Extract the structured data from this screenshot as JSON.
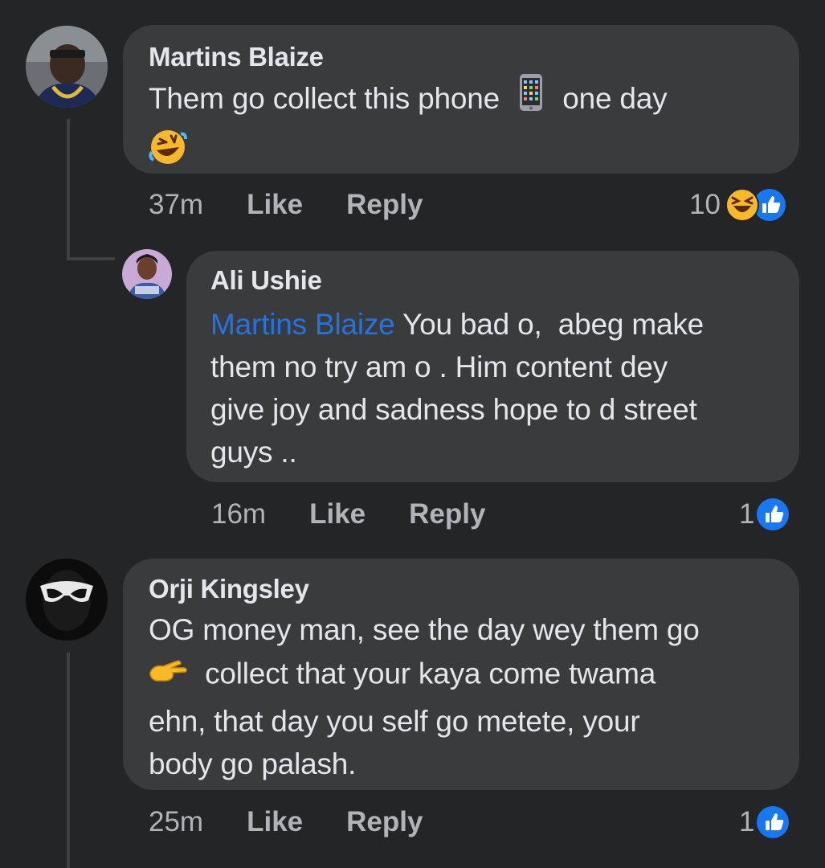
{
  "comments": [
    {
      "author": "Martins Blaize",
      "text_part1": "Them go collect this phone",
      "emoji1": "mobile-phone-emoji",
      "text_part2": "one day",
      "emoji2": "rolling-laughing-emoji",
      "time": "37m",
      "like_label": "Like",
      "reply_label": "Reply",
      "reaction_count": "10",
      "reactions": [
        "haha",
        "like"
      ]
    },
    {
      "author": "Ali Ushie",
      "mention": "Martins Blaize",
      "line1": "You bad o,  abeg make",
      "line2": "them no try am o . Him content dey",
      "line3": "give joy and sadness hope to d street",
      "line4": "guys ..",
      "time": "16m",
      "like_label": "Like",
      "reply_label": "Reply",
      "reaction_count": "1",
      "reactions": [
        "like"
      ]
    },
    {
      "author": "Orji Kingsley",
      "line1": "OG money man, see the day wey them go",
      "emoji1": "pointing-hand-emoji",
      "line2": "collect that your kaya come twama",
      "line3": "ehn, that day you self go metete, your",
      "line4": "body go palash.",
      "time": "25m",
      "like_label": "Like",
      "reply_label": "Reply",
      "reaction_count": "1",
      "reactions": [
        "like"
      ]
    }
  ],
  "colors": {
    "background": "#242526",
    "bubble": "#3a3b3c",
    "text": "#e4e6eb",
    "meta": "#b0b3b8",
    "mention": "#2374e1",
    "like_blue": "#1877f2"
  }
}
